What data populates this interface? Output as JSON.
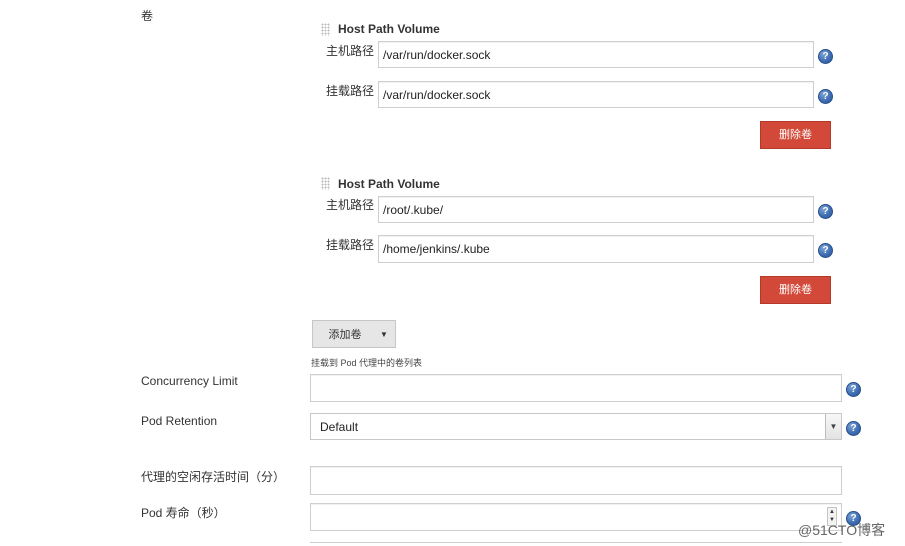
{
  "volumes_label": "卷",
  "volumes": [
    {
      "title": "Host Path Volume",
      "host_path_label": "主机路径",
      "host_path_value": "/var/run/docker.sock",
      "mount_path_label": "挂载路径",
      "mount_path_value": "/var/run/docker.sock",
      "delete_label": "删除卷"
    },
    {
      "title": "Host Path Volume",
      "host_path_label": "主机路径",
      "host_path_value": "/root/.kube/",
      "mount_path_label": "挂载路径",
      "mount_path_value": "/home/jenkins/.kube",
      "delete_label": "删除卷"
    }
  ],
  "add_volume": {
    "label": "添加卷",
    "description": "挂载到 Pod 代理中的卷列表"
  },
  "concurrency_limit": {
    "label": "Concurrency Limit",
    "value": ""
  },
  "pod_retention": {
    "label": "Pod Retention",
    "selected": "Default"
  },
  "agent_idle_time": {
    "label": "代理的空闲存活时间（分）",
    "value": ""
  },
  "pod_lifetime": {
    "label": "Pod 寿命（秒）",
    "value": ""
  },
  "help_glyph": "?",
  "watermark": "@51CTO博客",
  "colors": {
    "delete_button": "#d24939",
    "help_icon": "#3f6fb4",
    "add_button": "#e6e6e6"
  }
}
